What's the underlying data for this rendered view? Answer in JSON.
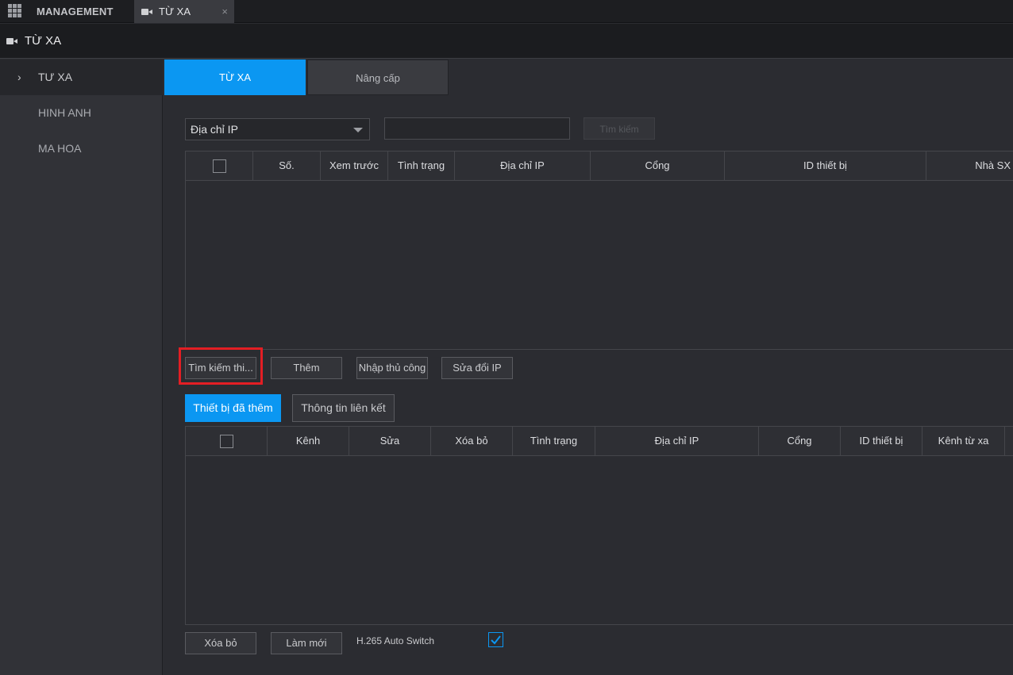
{
  "topbar": {
    "management_label": "MANAGEMENT",
    "active_tab_label": "TỪ XA",
    "close_glyph": "×"
  },
  "window": {
    "title": "TỪ XA"
  },
  "sidebar": {
    "items": [
      {
        "label": "TƯ XA",
        "active": true
      },
      {
        "label": "HINH ANH",
        "active": false
      },
      {
        "label": "MA HOA",
        "active": false
      }
    ]
  },
  "subtabs": [
    {
      "label": "TỪ XA"
    },
    {
      "label": "Nâng cấp"
    }
  ],
  "search": {
    "filter_value": "Địa chỉ IP",
    "input_value": "",
    "search_button": "Tìm kiếm"
  },
  "top_table": {
    "columns": [
      "Số.",
      "Xem trước",
      "Tình trạng",
      "Địa chỉ IP",
      "Cổng",
      "ID thiết bị",
      "Nhà SX"
    ]
  },
  "actions": {
    "search_device": "Tìm kiếm thi...",
    "add": "Thêm",
    "manual_add": "Nhập thủ công",
    "modify_ip": "Sửa đổi IP"
  },
  "lower_tabs": {
    "added_devices": "Thiết bị đã thêm",
    "link_info": "Thông tin liên kết"
  },
  "bottom_table": {
    "columns": [
      "Kênh",
      "Sửa",
      "Xóa bỏ",
      "Tình trạng",
      "Địa chỉ IP",
      "Cổng",
      "ID thiết bị",
      "Kênh từ xa"
    ]
  },
  "footer": {
    "delete": "Xóa bỏ",
    "refresh": "Làm mới",
    "h265_label": "H.265 Auto Switch",
    "h265_checked": true
  },
  "colors": {
    "accent": "#0b97f2",
    "highlight": "#e31e24"
  }
}
